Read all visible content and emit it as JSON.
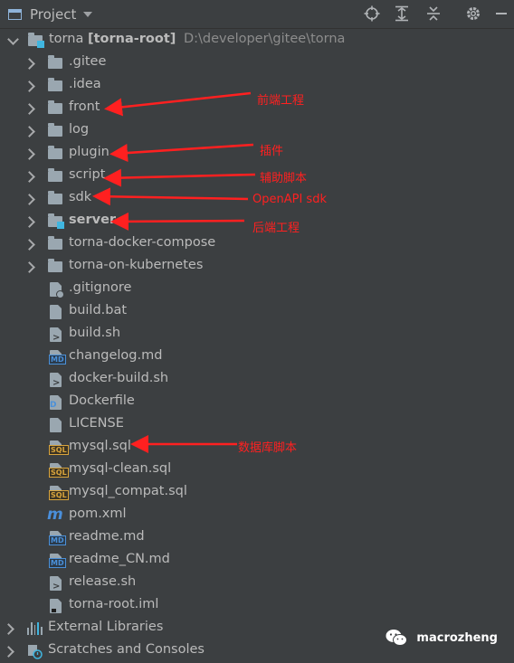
{
  "toolbar": {
    "title": "Project",
    "icons": [
      "crosshair-icon",
      "expand-all-icon",
      "collapse-all-icon",
      "gear-icon",
      "minimize-icon"
    ]
  },
  "tree": {
    "root": {
      "name": "torna",
      "module": "[torna-root]",
      "path": "D:\\developer\\gitee\\torna"
    },
    "items": [
      {
        "label": ".gitee",
        "type": "folder"
      },
      {
        "label": ".idea",
        "type": "folder"
      },
      {
        "label": "front",
        "type": "folder"
      },
      {
        "label": "log",
        "type": "folder"
      },
      {
        "label": "plugin",
        "type": "folder"
      },
      {
        "label": "script",
        "type": "folder"
      },
      {
        "label": "sdk",
        "type": "folder"
      },
      {
        "label": "server",
        "type": "module"
      },
      {
        "label": "torna-docker-compose",
        "type": "folder"
      },
      {
        "label": "torna-on-kubernetes",
        "type": "folder"
      },
      {
        "label": ".gitignore",
        "type": "ignore"
      },
      {
        "label": "build.bat",
        "type": "text"
      },
      {
        "label": "build.sh",
        "type": "shell"
      },
      {
        "label": "changelog.md",
        "type": "md"
      },
      {
        "label": "docker-build.sh",
        "type": "shell"
      },
      {
        "label": "Dockerfile",
        "type": "docker"
      },
      {
        "label": "LICENSE",
        "type": "text"
      },
      {
        "label": "mysql.sql",
        "type": "sql"
      },
      {
        "label": "mysql-clean.sql",
        "type": "sql"
      },
      {
        "label": "mysql_compat.sql",
        "type": "sql"
      },
      {
        "label": "pom.xml",
        "type": "maven"
      },
      {
        "label": "readme.md",
        "type": "md"
      },
      {
        "label": "readme_CN.md",
        "type": "md"
      },
      {
        "label": "release.sh",
        "type": "shell"
      },
      {
        "label": "torna-root.iml",
        "type": "iml"
      }
    ],
    "external_libraries": "External Libraries",
    "scratches": "Scratches and Consoles"
  },
  "annotations": {
    "front": "前端工程",
    "plugin": "插件",
    "script": "辅助脚本",
    "sdk": "OpenAPI sdk",
    "server": "后端工程",
    "mysql": "数据库脚本",
    "color": "#ff2020"
  },
  "watermark": {
    "text": "macrozheng",
    "icon": "wechat-icon"
  }
}
